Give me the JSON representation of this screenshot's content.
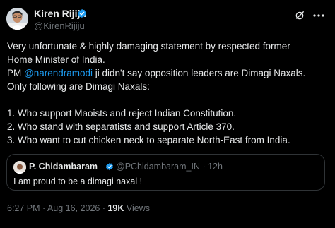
{
  "author": {
    "name": "Kiren Rijiju",
    "handle": "@KirenRijiju",
    "verified_color": "#1d9bf0"
  },
  "header_icons": [
    "grok-icon",
    "more-options-icon"
  ],
  "tweet": {
    "lines": [
      {
        "text": "Very unfortunate & highly damaging statement by respected former"
      },
      {
        "text": "Home Minister of India."
      },
      {
        "prefix": "PM ",
        "mention": "@narendramodi",
        "suffix": " ji didn't say opposition leaders are Dimagi Naxals."
      },
      {
        "text": "Only following are Dimagi Naxals:"
      },
      {
        "text": ""
      },
      {
        "text": "1. Who support Maoists and reject Indian Constitution."
      },
      {
        "text": "2. Who stand with separatists and support Article 370."
      },
      {
        "text": "3. Who want to cut chicken neck to separate North-East from India."
      }
    ]
  },
  "quoted": {
    "name": "P. Chidambaram",
    "handle_time": "@PChidambaram_IN · 12h",
    "text": "I am proud to be a dimagi naxal !"
  },
  "footer": {
    "time": "6:27 PM · Aug 16, 2026 · ",
    "views_count": "19K",
    "views_label": " Views"
  },
  "colors": {
    "background": "#000000",
    "text": "#e7e9ea",
    "secondary": "#71767b",
    "accent": "#1d9bf0",
    "border": "#2f3336"
  }
}
